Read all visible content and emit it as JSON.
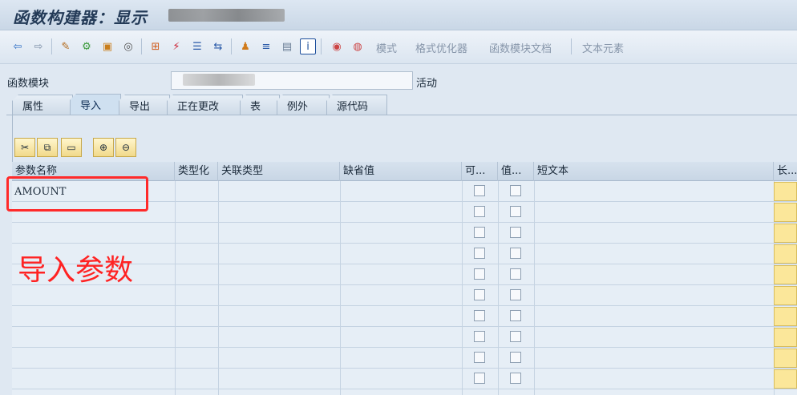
{
  "window": {
    "title": "函数构建器：显示"
  },
  "toolbar": {
    "text_buttons": [
      "模式",
      "格式优化器",
      "函数模块文档",
      "文本元素"
    ]
  },
  "function_module": {
    "label": "函数模块",
    "status": "活动"
  },
  "tabs": [
    "属性",
    "导入",
    "导出",
    "正在更改",
    "表",
    "例外",
    "源代码"
  ],
  "active_tab": "导入",
  "table": {
    "columns": [
      "参数名称",
      "类型化",
      "关联类型",
      "缺省值",
      "可...",
      "值...",
      "短文本",
      "长..."
    ],
    "rows": [
      {
        "name": "AMOUNT"
      }
    ]
  },
  "annotation": {
    "text": "导入参数"
  },
  "colors": {
    "highlight_box": "#ff2a2a",
    "annotation_text": "#ff2222",
    "long_text_cell": "#fbe79a"
  }
}
